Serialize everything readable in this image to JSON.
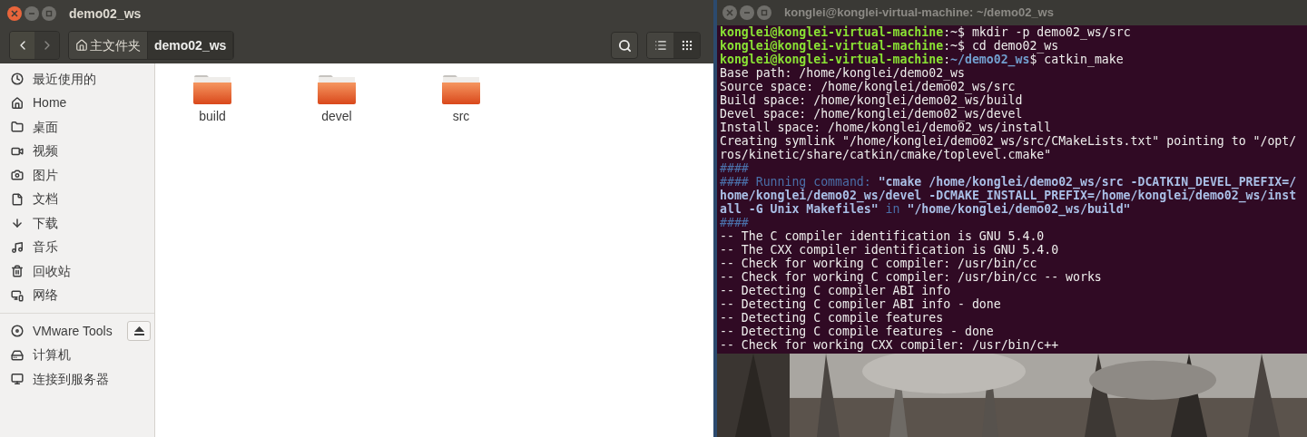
{
  "file_manager": {
    "window": {
      "title": "demo02_ws"
    },
    "nav": [
      {
        "kind": "back",
        "disabled": false
      },
      {
        "kind": "forward",
        "disabled": true
      }
    ],
    "path_bar": [
      {
        "label": "主文件夹",
        "kind": "home",
        "selected": false
      },
      {
        "label": "demo02_ws",
        "kind": "folder",
        "selected": true
      }
    ],
    "view_buttons": [
      {
        "kind": "list",
        "selected": false
      },
      {
        "kind": "grid",
        "selected": true
      }
    ],
    "sidebar": {
      "groups": [
        {
          "items": [
            {
              "label": "最近使用的",
              "kind": "recent"
            },
            {
              "label": "Home",
              "kind": "home"
            },
            {
              "label": "桌面",
              "kind": "folder"
            },
            {
              "label": "视频",
              "kind": "video"
            },
            {
              "label": "图片",
              "kind": "camera"
            },
            {
              "label": "文档",
              "kind": "document"
            },
            {
              "label": "下载",
              "kind": "download"
            },
            {
              "label": "音乐",
              "kind": "music"
            },
            {
              "label": "回收站",
              "kind": "trash"
            },
            {
              "label": "网络",
              "kind": "network"
            }
          ]
        },
        {
          "items": [
            {
              "label": "VMware Tools",
              "kind": "disc",
              "eject": true
            },
            {
              "label": "计算机",
              "kind": "computer"
            },
            {
              "label": "连接到服务器",
              "kind": "server"
            }
          ]
        }
      ]
    },
    "files": [
      {
        "name": "build"
      },
      {
        "name": "devel"
      },
      {
        "name": "src"
      }
    ]
  },
  "terminal": {
    "title": "konglei@konglei-virtual-machine: ~/demo02_ws",
    "lines": [
      [
        {
          "kind": "user",
          "text": "konglei@konglei-virtual-machine"
        },
        {
          "kind": "plain",
          "text": ":~$ mkdir -p demo02_ws/src"
        }
      ],
      [
        {
          "kind": "user",
          "text": "konglei@konglei-virtual-machine"
        },
        {
          "kind": "plain",
          "text": ":~$ cd demo02_ws"
        }
      ],
      [
        {
          "kind": "user",
          "text": "konglei@konglei-virtual-machine"
        },
        {
          "kind": "plain",
          "text": ":"
        },
        {
          "kind": "path",
          "text": "~/demo02_ws"
        },
        {
          "kind": "plain",
          "text": "$ catkin_make"
        }
      ],
      [
        {
          "kind": "plain",
          "text": "Base path: /home/konglei/demo02_ws"
        }
      ],
      [
        {
          "kind": "plain",
          "text": "Source space: /home/konglei/demo02_ws/src"
        }
      ],
      [
        {
          "kind": "plain",
          "text": "Build space: /home/konglei/demo02_ws/build"
        }
      ],
      [
        {
          "kind": "plain",
          "text": "Devel space: /home/konglei/demo02_ws/devel"
        }
      ],
      [
        {
          "kind": "plain",
          "text": "Install space: /home/konglei/demo02_ws/install"
        }
      ],
      [
        {
          "kind": "plain",
          "text": "Creating symlink \"/home/konglei/demo02_ws/src/CMakeLists.txt\" pointing to \"/opt/"
        }
      ],
      [
        {
          "kind": "plain",
          "text": "ros/kinetic/share/catkin/cmake/toplevel.cmake\""
        }
      ],
      [
        {
          "kind": "dim",
          "text": "####"
        }
      ],
      [
        {
          "kind": "dim",
          "text": "#### Running command: "
        },
        {
          "kind": "bold",
          "text": "\"cmake /home/konglei/demo02_ws/src -DCATKIN_DEVEL_PREFIX=/"
        }
      ],
      [
        {
          "kind": "bold",
          "text": "home/konglei/demo02_ws/devel -DCMAKE_INSTALL_PREFIX=/home/konglei/demo02_ws/inst"
        }
      ],
      [
        {
          "kind": "bold",
          "text": "all -G Unix Makefiles\""
        },
        {
          "kind": "dim",
          "text": " in "
        },
        {
          "kind": "bold",
          "text": "\"/home/konglei/demo02_ws/build\""
        }
      ],
      [
        {
          "kind": "dim",
          "text": "####"
        }
      ],
      [
        {
          "kind": "plain",
          "text": "-- The C compiler identification is GNU 5.4.0"
        }
      ],
      [
        {
          "kind": "plain",
          "text": "-- The CXX compiler identification is GNU 5.4.0"
        }
      ],
      [
        {
          "kind": "plain",
          "text": "-- Check for working C compiler: /usr/bin/cc"
        }
      ],
      [
        {
          "kind": "plain",
          "text": "-- Check for working C compiler: /usr/bin/cc -- works"
        }
      ],
      [
        {
          "kind": "plain",
          "text": "-- Detecting C compiler ABI info"
        }
      ],
      [
        {
          "kind": "plain",
          "text": "-- Detecting C compiler ABI info - done"
        }
      ],
      [
        {
          "kind": "plain",
          "text": "-- Detecting C compile features"
        }
      ],
      [
        {
          "kind": "plain",
          "text": "-- Detecting C compile features - done"
        }
      ],
      [
        {
          "kind": "plain",
          "text": "-- Check for working CXX compiler: /usr/bin/c++"
        }
      ]
    ]
  }
}
